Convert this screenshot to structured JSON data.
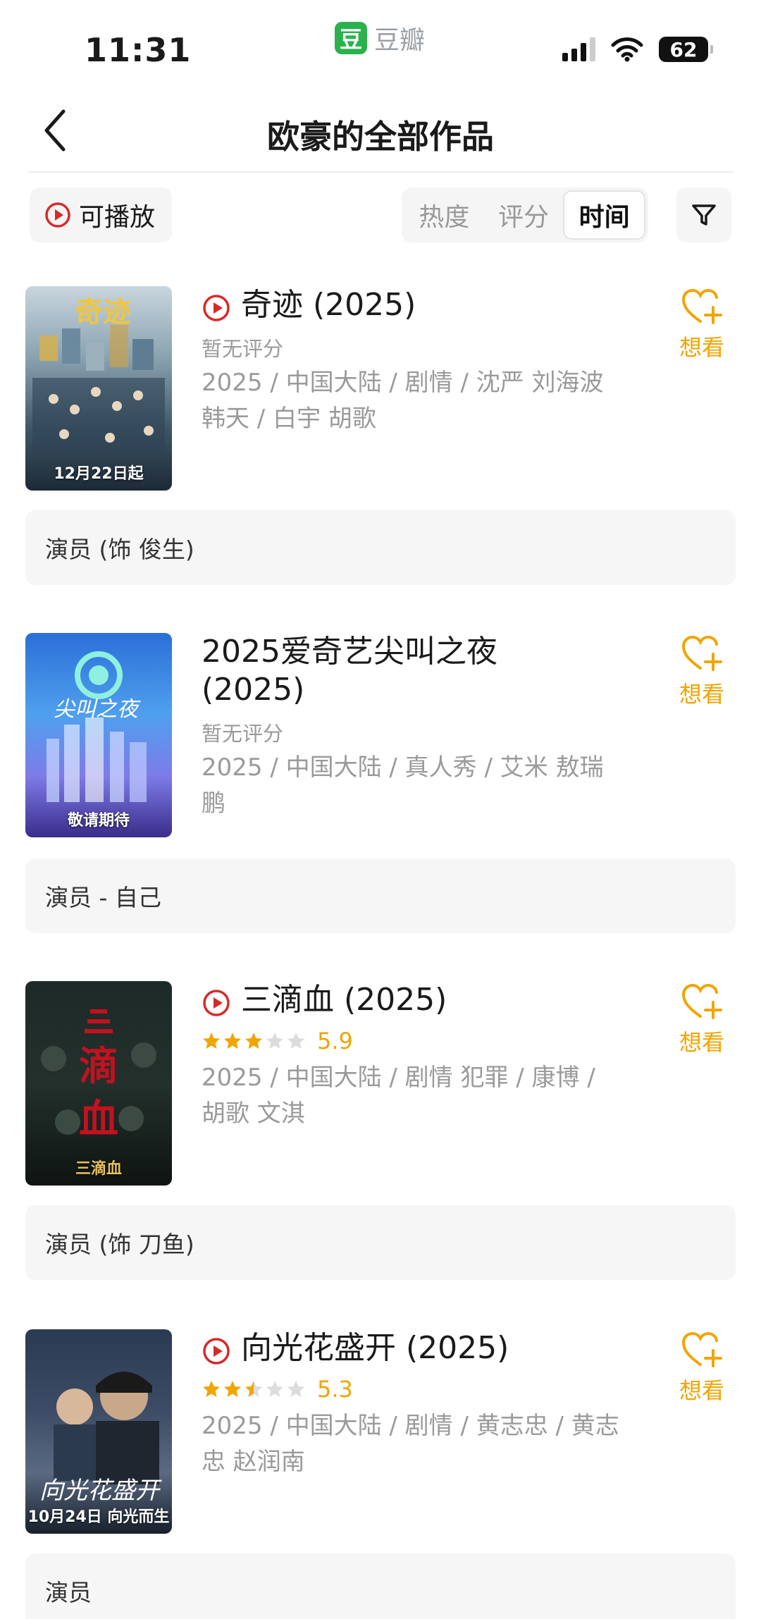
{
  "status_bar": {
    "time": "11:31",
    "app_logo": "豆",
    "app_name": "豆瓣",
    "battery": "62"
  },
  "nav": {
    "title": "欧豪的全部作品",
    "back_icon": "chevron-left-icon"
  },
  "filters": {
    "playable_label": "可播放",
    "sort_tabs": [
      {
        "label": "热度",
        "active": false
      },
      {
        "label": "评分",
        "active": false
      },
      {
        "label": "时间",
        "active": true
      }
    ],
    "filter_icon": "funnel-icon"
  },
  "colors": {
    "accent_red": "#d62a2a",
    "star_orange": "#f0a500",
    "wish_orange": "#f0a500"
  },
  "items": [
    {
      "playable": true,
      "title": "奇迹 (2025)",
      "rating_text": "暂无评分",
      "meta": "2025 / 中国大陆 / 剧情 / 沈严 刘海波 韩天 / 白宇 胡歌",
      "wish_label": "想看",
      "role": "演员 (饰 俊生)",
      "poster_caption": "12月22日起"
    },
    {
      "playable": false,
      "title": "2025爱奇艺尖叫之夜 (2025)",
      "rating_text": "暂无评分",
      "meta": "2025 / 中国大陆 / 真人秀 / 艾米 敖瑞鹏",
      "wish_label": "想看",
      "role": "演员 - 自己",
      "poster_caption": "敬请期待"
    },
    {
      "playable": true,
      "title": "三滴血 (2025)",
      "rating_stars": 3,
      "rating_value": "5.9",
      "meta": "2025 / 中国大陆 / 剧情 犯罪 / 康博 / 胡歌 文淇",
      "wish_label": "想看",
      "role": "演员 (饰 刀鱼)",
      "poster_caption": "三滴血"
    },
    {
      "playable": true,
      "title": "向光花盛开 (2025)",
      "rating_stars": 2.5,
      "rating_value": "5.3",
      "meta": "2025 / 中国大陆 / 剧情 / 黄志忠 / 黄志忠 赵润南",
      "wish_label": "想看",
      "role": "演员",
      "poster_caption": "10月24日 向光而生"
    }
  ]
}
